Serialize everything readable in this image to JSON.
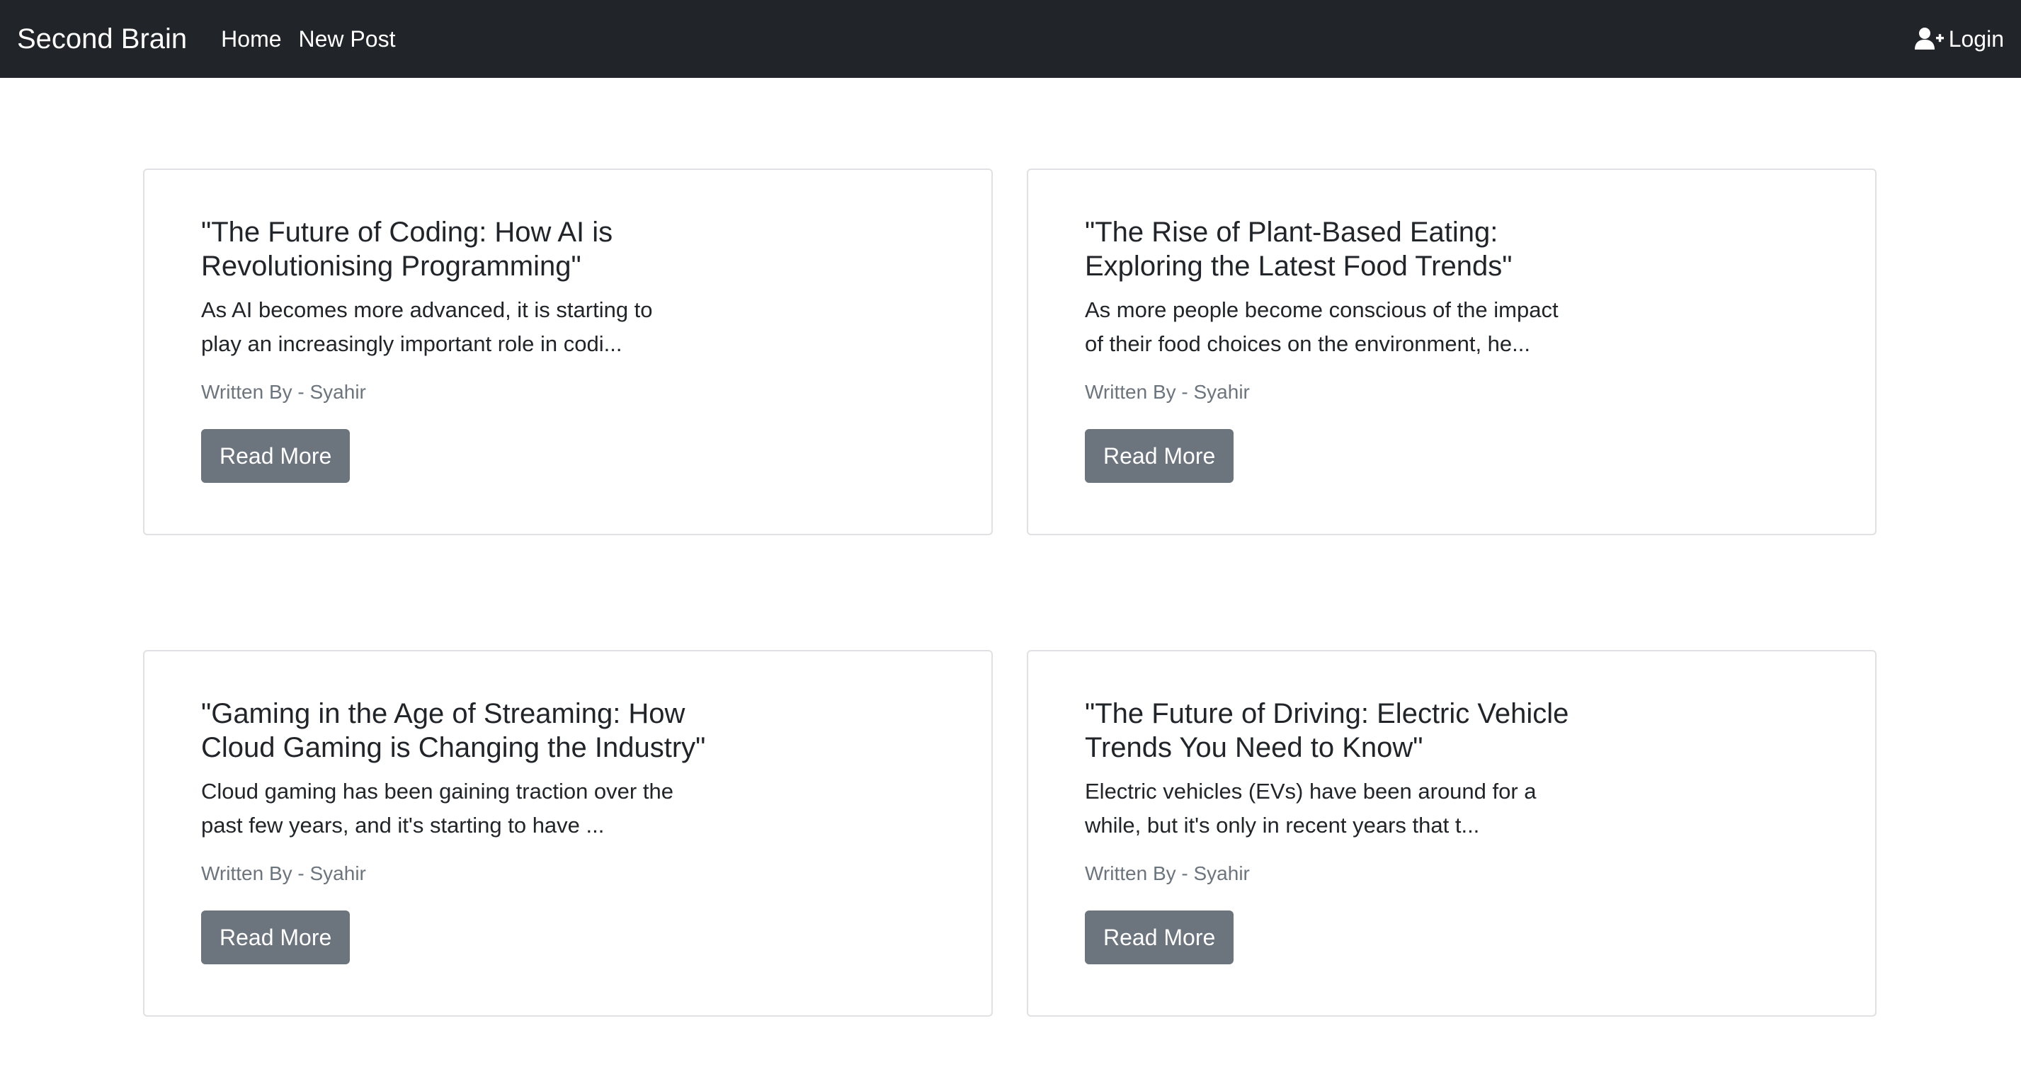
{
  "navbar": {
    "brand": "Second Brain",
    "links": [
      {
        "label": "Home"
      },
      {
        "label": "New Post"
      }
    ],
    "login_label": "Login",
    "login_icon": "user-plus-icon"
  },
  "posts": [
    {
      "title": "\"The Future of Coding: How AI is Revolutionising Programming\"",
      "excerpt": "As AI becomes more advanced, it is starting to play an increasingly important role in codi...",
      "author": "Written By - Syahir",
      "button_label": "Read More"
    },
    {
      "title": "\"The Rise of Plant-Based Eating: Exploring the Latest Food Trends\"",
      "excerpt": "As more people become conscious of the impact of their food choices on the environment, he...",
      "author": "Written By - Syahir",
      "button_label": "Read More"
    },
    {
      "title": "\"Gaming in the Age of Streaming: How Cloud Gaming is Changing the Industry\"",
      "excerpt": "Cloud gaming has been gaining traction over the past few years, and it's starting to have ...",
      "author": "Written By - Syahir",
      "button_label": "Read More"
    },
    {
      "title": "\"The Future of Driving: Electric Vehicle Trends You Need to Know\"",
      "excerpt": "Electric vehicles (EVs) have been around for a while, but it's only in recent years that t...",
      "author": "Written By - Syahir",
      "button_label": "Read More"
    }
  ],
  "colors": {
    "navbar_bg": "#212529",
    "button_bg": "#6c757d",
    "muted_text": "#6c757d"
  }
}
